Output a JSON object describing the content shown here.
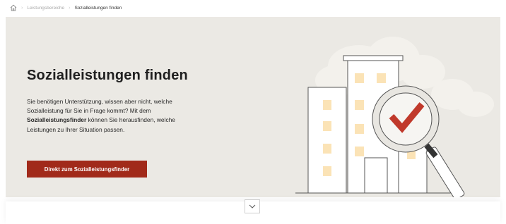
{
  "breadcrumb": {
    "home_icon": "house-icon",
    "items": [
      "Leistungsbereiche",
      "Sozialleistungen finden"
    ]
  },
  "hero": {
    "title": "Sozialleistungen finden",
    "text_part1": "Sie benötigen Unterstützung, wissen aber nicht, welche Sozialleistung für Sie in Frage kommt? Mit dem ",
    "text_bold": "Sozialleistungsfinder",
    "text_part2": " können Sie herausfinden, welche Leistungen zu Ihrer Situation passen.",
    "cta_label": "Direkt zum Sozialleistungsfinder",
    "illustration_icon": "building-magnifier-checkmark-icon"
  },
  "scroll_button": {
    "icon": "chevron-down-icon"
  },
  "colors": {
    "hero_background": "#ebe9e4",
    "accent": "#a12a1a",
    "window": "#fbe3b6",
    "check": "#c0392b"
  }
}
